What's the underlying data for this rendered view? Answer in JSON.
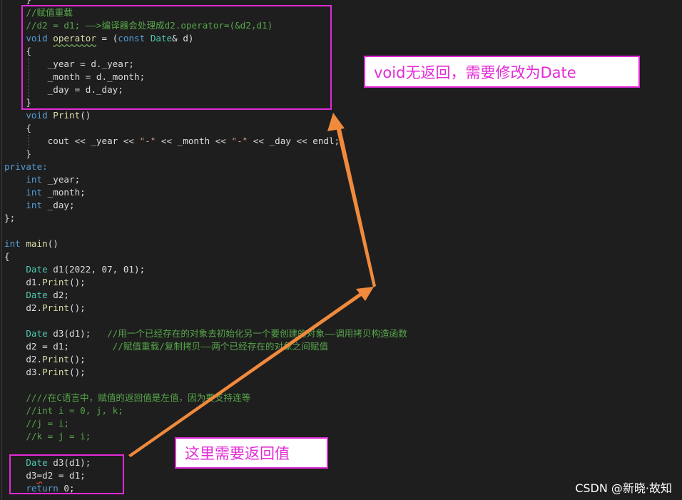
{
  "code": {
    "l0": "}",
    "l1": "//赋值重载",
    "l2": "//d2 = d1; ——>编译器会处理成d2.operator=(&d2,d1)",
    "l3": {
      "void": "void",
      "op": "operator",
      "rest1": " = (",
      "const": "const",
      "type": "Date",
      "rest2": "& d)"
    },
    "l4": "{",
    "l5": "_year = d._year;",
    "l6": "_month = d._month;",
    "l7": "_day = d._day;",
    "l8": "}",
    "l9": {
      "void": "void",
      "name": "Print",
      "rest": "()"
    },
    "l10": "{",
    "l11": {
      "cout": "cout",
      "a": " << _year << ",
      "s1": "\"-\"",
      "b": " << _month << ",
      "s2": "\"-\"",
      "c": " << _day << ",
      "endl": "endl",
      "d": ";"
    },
    "l12": "}",
    "l13": "private:",
    "l14": {
      "kw": "int",
      "rest": " _year;"
    },
    "l15": {
      "kw": "int",
      "rest": " _month;"
    },
    "l16": {
      "kw": "int",
      "rest": " _day;"
    },
    "l17": "};",
    "l19": {
      "kw": "int",
      "name": "main",
      "rest": "()"
    },
    "l20": "{",
    "l21": {
      "type": "Date",
      "rest": " d1(2022, 07, 01);"
    },
    "l22": {
      "obj": "d1.",
      "fn": "Print",
      "rest": "();"
    },
    "l23": {
      "type": "Date",
      "rest": " d2;"
    },
    "l24": {
      "obj": "d2.",
      "fn": "Print",
      "rest": "();"
    },
    "l26": {
      "type": "Date",
      "rest": " d3(d1);   ",
      "comment": "//用一个已经存在的对象去初始化另一个要创建的对象——调用拷贝构造函数"
    },
    "l27": {
      "code": "d2 = d1;        ",
      "comment": "//赋值重载/复制拷贝——两个已经存在的对象之间赋值"
    },
    "l28": {
      "obj": "d2.",
      "fn": "Print",
      "rest": "();"
    },
    "l29": {
      "obj": "d3.",
      "fn": "Print",
      "rest": "();"
    },
    "l31": "////在C语言中，赋值的返回值是左值，因为要支持连等",
    "l32": "//int i = 0, j, k;",
    "l33": "//j = i;",
    "l34": "//k = j = i;",
    "l36": {
      "type": "Date",
      "rest": " d3(d1);"
    },
    "l37": {
      "a": "d3",
      "eq": "=",
      "b": "d2 = d1;"
    },
    "l38": {
      "kw": "return",
      "rest": " 0;"
    }
  },
  "annotations": {
    "callout_top": "void无返回，需要修改为Date",
    "callout_bottom": "这里需要返回值"
  },
  "colors": {
    "accent": "#e22ad6",
    "arrow": "#f08a3c",
    "background": "#1e1e1e",
    "keyword": "#569cd6",
    "type": "#4ec9b0",
    "function": "#dcdcaa",
    "comment": "#57a64a",
    "string": "#d69d85"
  },
  "watermark": "CSDN @新晓·故知"
}
